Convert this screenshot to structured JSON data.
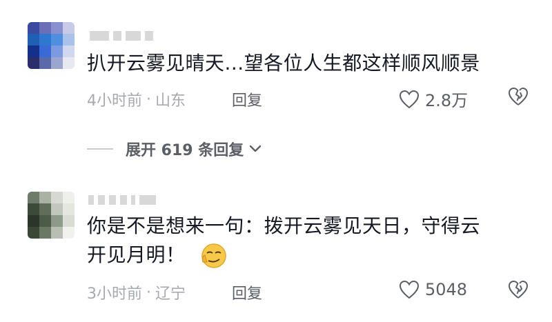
{
  "comments": [
    {
      "text": "扒开云雾见晴天...望各位人生都这样顺风顺景",
      "time": "4小时前",
      "location": "山东",
      "reply_label": "回复",
      "likes": "2.8万",
      "expand_label": "展开 619 条回复",
      "avatar_colors": [
        "#3b4aa0",
        "#6a6fb8",
        "#8a8fcf",
        "#c9c9e8",
        "#1f5fb5",
        "#2f78d0",
        "#4f8fe0",
        "#a9c2ea",
        "#14308a",
        "#3a6ad8",
        "#7b9ae0",
        "#cfd8ee",
        "#2a2f6a",
        "#5a6aa8",
        "#9aa6d0",
        "#e8e8f0"
      ]
    },
    {
      "text_line1": "你是不是想来一句：拨开云雾见天日，守得云",
      "text_line2": "开见月明！",
      "emoji_name": "smirk-emoji-icon",
      "time": "3小时前",
      "location": "辽宁",
      "reply_label": "回复",
      "likes": "5048",
      "avatar_colors": [
        "#6e7a6a",
        "#a9b2a4",
        "#d6d9d2",
        "#eef0ec",
        "#3c4a3a",
        "#5f6d5a",
        "#c2c7bd",
        "#e4e6e0",
        "#2b3529",
        "#4d5b49",
        "#8e9a89",
        "#d9dcd5",
        "#3a4636",
        "#6b7866",
        "#b8beb2",
        "#f1f2ee"
      ]
    }
  ],
  "separator": "·"
}
